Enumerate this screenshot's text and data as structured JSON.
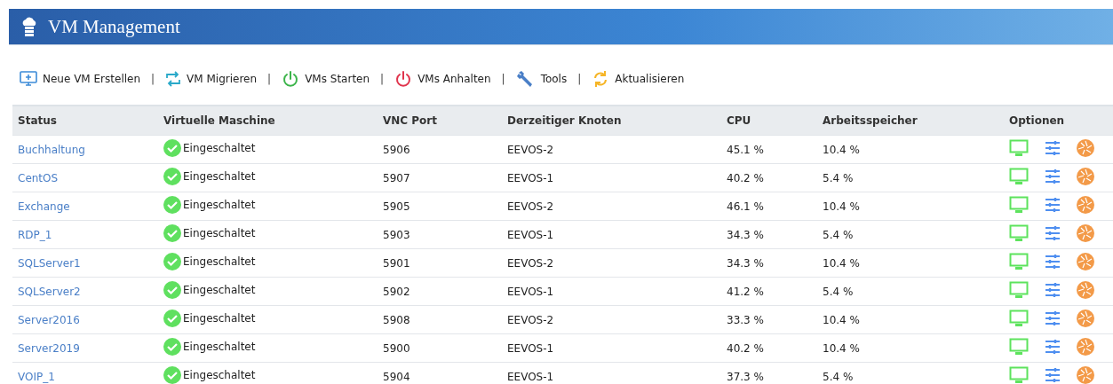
{
  "header": {
    "title": "VM Management"
  },
  "toolbar": [
    {
      "label": "Neue VM Erstellen",
      "kind": "create"
    },
    {
      "label": "VM Migrieren",
      "kind": "migrate"
    },
    {
      "label": "VMs Starten",
      "kind": "start"
    },
    {
      "label": "VMs Anhalten",
      "kind": "stop"
    },
    {
      "label": "Tools",
      "kind": "tools"
    },
    {
      "label": "Aktualisieren",
      "kind": "refresh"
    }
  ],
  "separator": "|",
  "table": {
    "columns": [
      "Status",
      "Virtuelle Maschine",
      "VNC Port",
      "Derzeitiger Knoten",
      "CPU",
      "Arbeitsspeicher",
      "Optionen"
    ],
    "rows": [
      {
        "name": "Buchhaltung",
        "state": "Eingeschaltet",
        "running": true,
        "vnc_port": "5906",
        "node": "EEVOS-2",
        "cpu": "45.1 %",
        "memory": "10.4 %"
      },
      {
        "name": "CentOS",
        "state": "Eingeschaltet",
        "running": true,
        "vnc_port": "5907",
        "node": "EEVOS-1",
        "cpu": "40.2 %",
        "memory": "5.4 %"
      },
      {
        "name": "Exchange",
        "state": "Eingeschaltet",
        "running": true,
        "vnc_port": "5905",
        "node": "EEVOS-2",
        "cpu": "46.1 %",
        "memory": "10.4 %"
      },
      {
        "name": "RDP_1",
        "state": "Eingeschaltet",
        "running": true,
        "vnc_port": "5903",
        "node": "EEVOS-1",
        "cpu": "34.3 %",
        "memory": "5.4 %"
      },
      {
        "name": "SQLServer1",
        "state": "Eingeschaltet",
        "running": true,
        "vnc_port": "5901",
        "node": "EEVOS-2",
        "cpu": "34.3 %",
        "memory": "10.4 %"
      },
      {
        "name": "SQLServer2",
        "state": "Eingeschaltet",
        "running": true,
        "vnc_port": "5902",
        "node": "EEVOS-1",
        "cpu": "41.2 %",
        "memory": "5.4 %"
      },
      {
        "name": "Server2016",
        "state": "Eingeschaltet",
        "running": true,
        "vnc_port": "5908",
        "node": "EEVOS-2",
        "cpu": "33.3 %",
        "memory": "10.4 %"
      },
      {
        "name": "Server2019",
        "state": "Eingeschaltet",
        "running": true,
        "vnc_port": "5900",
        "node": "EEVOS-1",
        "cpu": "40.2 %",
        "memory": "10.4 %"
      },
      {
        "name": "VOIP_1",
        "state": "Eingeschaltet",
        "running": true,
        "vnc_port": "5904",
        "node": "EEVOS-1",
        "cpu": "37.3 %",
        "memory": "5.4 %"
      }
    ]
  }
}
